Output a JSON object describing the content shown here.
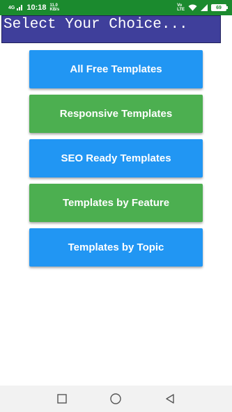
{
  "status_bar": {
    "network": "4G",
    "time": "10:18",
    "speed_value": "11.0",
    "speed_unit": "KB/s",
    "volte_top": "Vo",
    "volte_bottom": "LTE",
    "battery": "69"
  },
  "header": {
    "title": "Select Your Choice..."
  },
  "menu": {
    "items": [
      {
        "label": "All Free Templates",
        "color": "#2196f3"
      },
      {
        "label": "Responsive Templates",
        "color": "#4caf50"
      },
      {
        "label": "SEO Ready Templates",
        "color": "#2196f3"
      },
      {
        "label": "Templates by Feature",
        "color": "#4caf50"
      },
      {
        "label": "Templates by Topic",
        "color": "#2196f3"
      }
    ]
  },
  "nav_bar": {
    "icons": [
      "recent-apps-icon",
      "home-icon",
      "back-icon"
    ]
  },
  "colors": {
    "status_bar": "#1b8a2e",
    "header": "#3f3f9b",
    "blue": "#2196f3",
    "green": "#4caf50"
  }
}
